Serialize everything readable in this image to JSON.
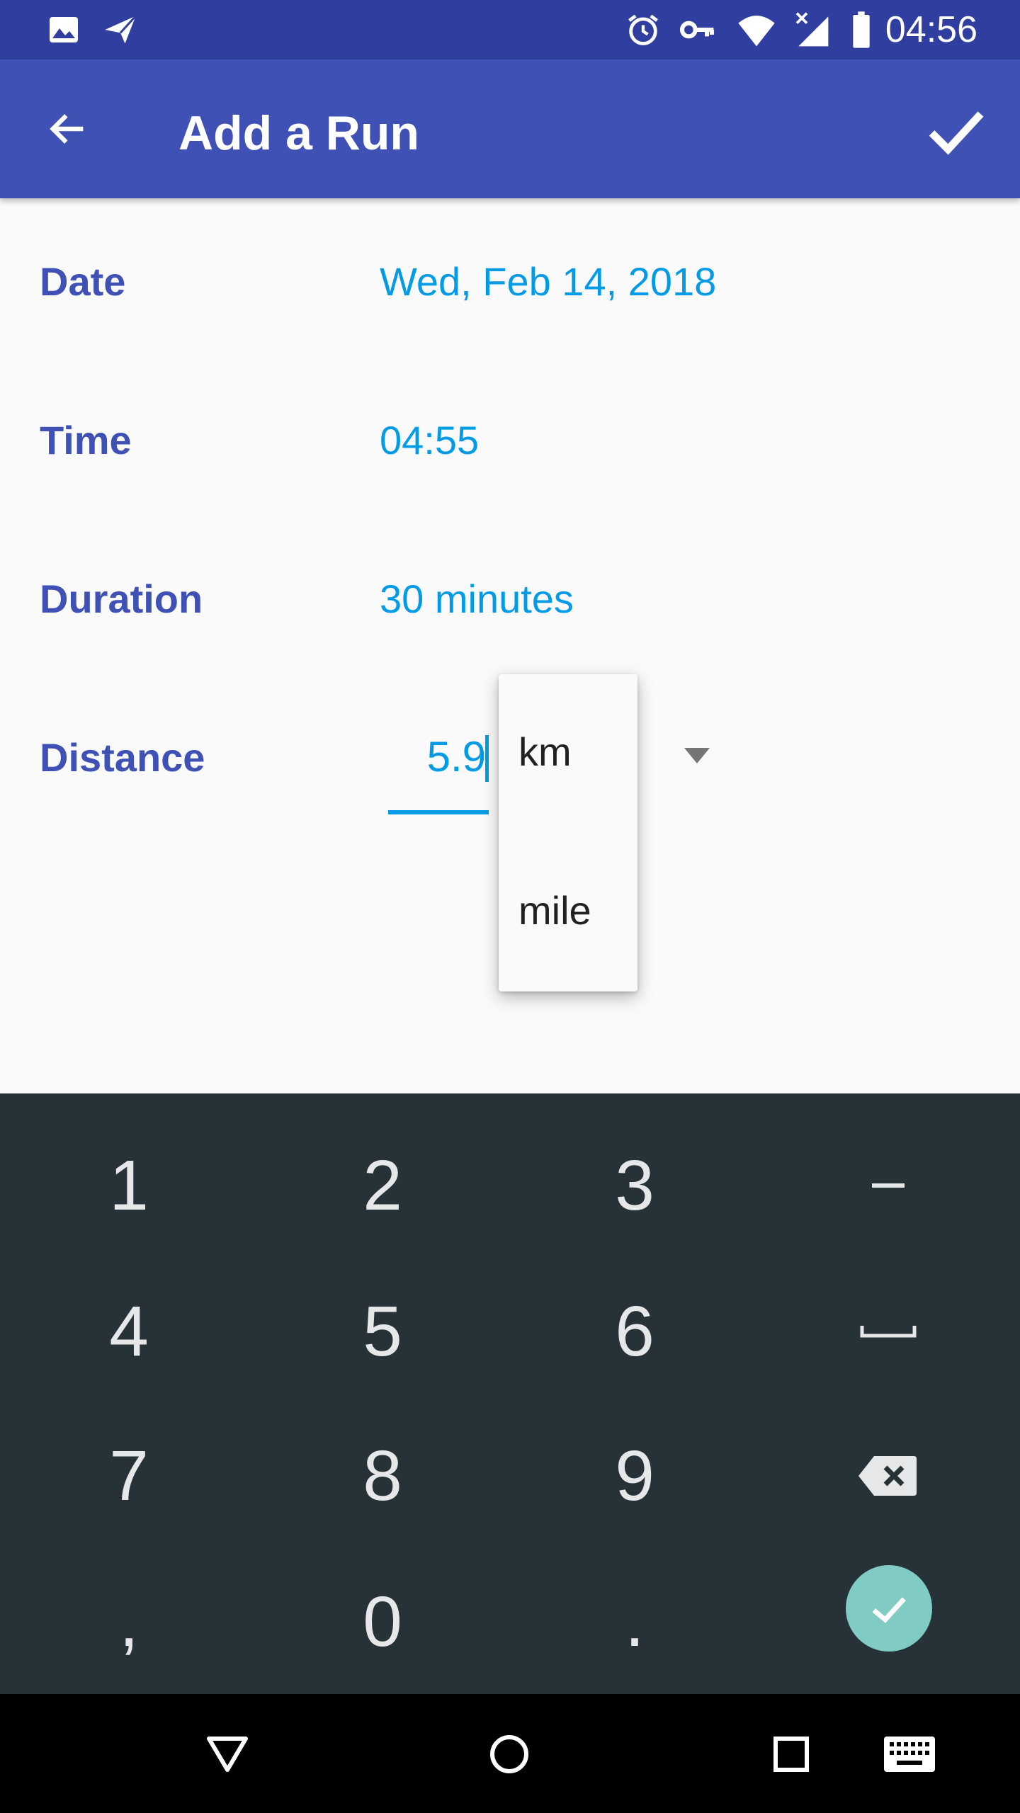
{
  "status_bar": {
    "time": "04:56",
    "left_icons": [
      "image-icon",
      "send-icon"
    ],
    "right_icons": [
      "alarm-icon",
      "vpn-key-icon",
      "wifi-icon",
      "signal-off-icon",
      "battery-icon"
    ]
  },
  "app_bar": {
    "title": "Add a Run",
    "back_icon": "arrow-back-icon",
    "save_icon": "checkmark-icon"
  },
  "form": {
    "date": {
      "label": "Date",
      "value": "Wed, Feb 14, 2018"
    },
    "time": {
      "label": "Time",
      "value": "04:55"
    },
    "duration": {
      "label": "Duration",
      "value": "30 minutes"
    },
    "distance": {
      "label": "Distance",
      "value": "5.9"
    }
  },
  "unit_dropdown": {
    "options": [
      "km",
      "mile"
    ]
  },
  "keyboard": {
    "keys": [
      [
        "1",
        "2",
        "3",
        "−"
      ],
      [
        "4",
        "5",
        "6",
        "space"
      ],
      [
        "7",
        "8",
        "9",
        "backspace"
      ],
      [
        ",",
        "0",
        ".",
        "enter"
      ]
    ]
  },
  "nav_bar": {
    "buttons": [
      "back-triangle-icon",
      "home-circle-icon",
      "recents-square-icon",
      "keyboard-icon"
    ]
  },
  "colors": {
    "status_bar": "#303f9f",
    "app_bar": "#3f51b5",
    "label": "#3f51b5",
    "value": "#039be5",
    "keyboard_bg": "#263238",
    "enter_key": "#80cbc4"
  }
}
